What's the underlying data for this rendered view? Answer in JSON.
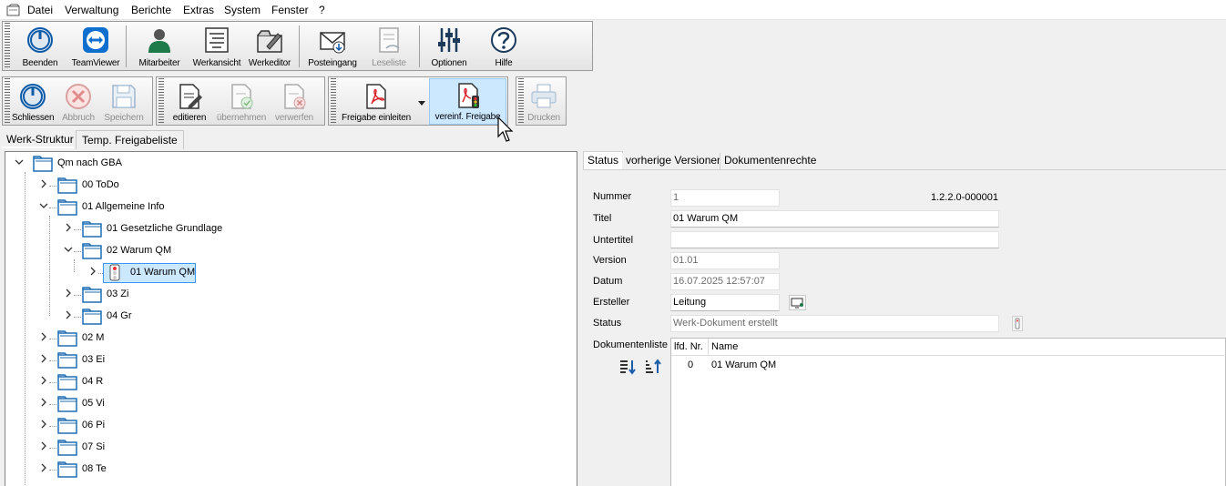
{
  "menu": {
    "items": [
      "Datei",
      "Verwaltung",
      "Berichte",
      "Extras",
      "System",
      "Fenster",
      "?"
    ]
  },
  "toolbar1": {
    "buttons": [
      {
        "label": "Beenden",
        "icon": "power-icon",
        "enabled": true
      },
      {
        "label": "TeamViewer",
        "icon": "teamviewer-icon",
        "enabled": true
      },
      {
        "label": "Mitarbeiter",
        "icon": "person-icon",
        "enabled": true
      },
      {
        "label": "Werkansicht",
        "icon": "document-view-icon",
        "enabled": true
      },
      {
        "label": "Werkeditor",
        "icon": "editor-icon",
        "enabled": true
      },
      {
        "label": "Posteingang",
        "icon": "mail-inbox-icon",
        "enabled": true
      },
      {
        "label": "Leseliste",
        "icon": "reading-list-icon",
        "enabled": false
      },
      {
        "label": "Optionen",
        "icon": "sliders-icon",
        "enabled": true
      },
      {
        "label": "Hilfe",
        "icon": "help-icon",
        "enabled": true
      }
    ]
  },
  "toolbar2": {
    "buttons": [
      {
        "label": "Schliessen",
        "icon": "power-icon",
        "enabled": true
      },
      {
        "label": "Abbruch",
        "icon": "cancel-icon",
        "enabled": false
      },
      {
        "label": "Speichern",
        "icon": "save-icon",
        "enabled": false
      },
      {
        "label": "editieren",
        "icon": "edit-document-icon",
        "enabled": true
      },
      {
        "label": "übernehmen",
        "icon": "accept-document-icon",
        "enabled": false
      },
      {
        "label": "verwerfen",
        "icon": "discard-document-icon",
        "enabled": false
      },
      {
        "label": "Freigabe einleiten",
        "icon": "pdf-icon",
        "enabled": true
      },
      {
        "label": "vereinf. Freigabe",
        "icon": "pdf-traffic-light-icon",
        "enabled": true
      },
      {
        "label": "Drucken",
        "icon": "printer-icon",
        "enabled": false
      }
    ]
  },
  "left_tabs": [
    "Werk-Struktur",
    "Temp. Freigabeliste"
  ],
  "tree": [
    {
      "label": "Qm nach GBA",
      "expanded": true,
      "type": "folder"
    },
    {
      "label": "00 ToDo",
      "expanded": false,
      "type": "folder"
    },
    {
      "label": "01 Allgemeine Info",
      "expanded": true,
      "type": "folder"
    },
    {
      "label": "01 Gesetzliche Grundlage",
      "expanded": false,
      "type": "folder"
    },
    {
      "label": "02 Warum QM",
      "expanded": true,
      "type": "folder"
    },
    {
      "label": "01 Warum QM",
      "expanded": false,
      "type": "document",
      "selected": true
    },
    {
      "label": "03 Zi",
      "expanded": false,
      "type": "folder"
    },
    {
      "label": "04 Gr",
      "expanded": false,
      "type": "folder"
    },
    {
      "label": "02 M",
      "expanded": false,
      "type": "folder"
    },
    {
      "label": "03 Ei",
      "expanded": false,
      "type": "folder"
    },
    {
      "label": "04 R",
      "expanded": false,
      "type": "folder"
    },
    {
      "label": "05 Vi",
      "expanded": false,
      "type": "folder"
    },
    {
      "label": "06 Pi",
      "expanded": false,
      "type": "folder"
    },
    {
      "label": "07 Si",
      "expanded": false,
      "type": "folder"
    },
    {
      "label": "08 Te",
      "expanded": false,
      "type": "folder"
    }
  ],
  "right_tabs": [
    "Status",
    "vorherige Versionen",
    "Dokumentenrechte"
  ],
  "form": {
    "nummer_label": "Nummer",
    "nummer": "1",
    "code": "1.2.2.0-000001",
    "titel_label": "Titel",
    "titel": "01 Warum QM",
    "untertitel_label": "Untertitel",
    "untertitel": "",
    "version_label": "Version",
    "version": "01.01",
    "datum_label": "Datum",
    "datum": "16.07.2025 12:57:07",
    "ersteller_label": "Ersteller",
    "ersteller": "Leitung",
    "status_label": "Status",
    "status": "Werk-Dokument erstellt",
    "dokliste_label": "Dokumentenliste"
  },
  "doclist": {
    "headers": [
      "lfd. Nr.",
      "Name"
    ],
    "rows": [
      {
        "nr": "0",
        "name": "01 Warum QM"
      }
    ]
  },
  "colors": {
    "selected_bg": "#cce8ff",
    "selected_border": "#3399ff",
    "folder_blue": "#1f6fb5",
    "accent_blue": "#0b5aa8",
    "pdf_red": "#d9252b"
  }
}
